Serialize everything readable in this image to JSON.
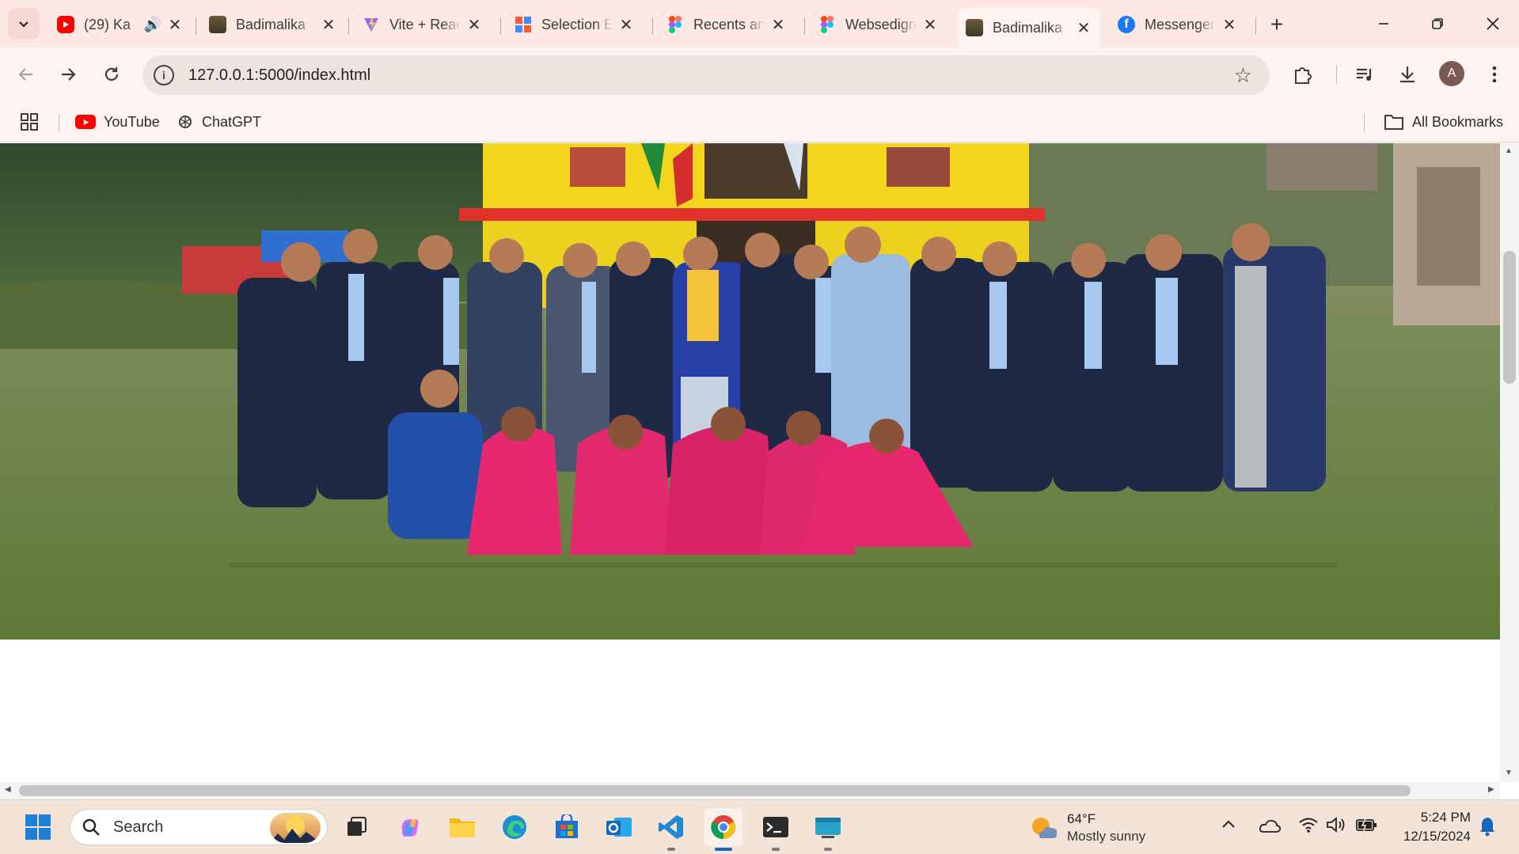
{
  "browser": {
    "tabs": [
      {
        "title": "(29) Ka",
        "favicon": "youtube-icon",
        "audio": true,
        "active": false
      },
      {
        "title": "Badimalika",
        "favicon": "site-photo-icon",
        "active": false
      },
      {
        "title": "Vite + React",
        "favicon": "vite-icon",
        "active": false
      },
      {
        "title": "Selection E",
        "favicon": "selection-icon",
        "active": false
      },
      {
        "title": "Recents an",
        "favicon": "figma-icon",
        "active": false
      },
      {
        "title": "Websedign",
        "favicon": "figma-icon",
        "active": false
      },
      {
        "title": "Badimalika",
        "favicon": "site-photo-icon",
        "active": true
      },
      {
        "title": "Messenger",
        "favicon": "facebook-icon",
        "active": false
      }
    ],
    "new_tab_symbol": "+",
    "url": "127.0.0.1:5000/index.html",
    "profile_initial": "A",
    "bookmarks": [
      {
        "label": "YouTube",
        "icon": "youtube-icon"
      },
      {
        "label": "ChatGPT",
        "icon": "chatgpt-icon"
      }
    ],
    "all_bookmarks_label": "All Bookmarks"
  },
  "taskbar": {
    "search_placeholder": "Search",
    "weather": {
      "temp": "64°F",
      "condition": "Mostly sunny"
    },
    "clock": {
      "time": "5:24 PM",
      "date": "12/15/2024"
    }
  },
  "colors": {
    "tab_strip_bg": "#fde8e4",
    "toolbar_bg": "#fdf3f1",
    "taskbar_bg": "#f4e4d7",
    "accent": "#1565c0"
  }
}
